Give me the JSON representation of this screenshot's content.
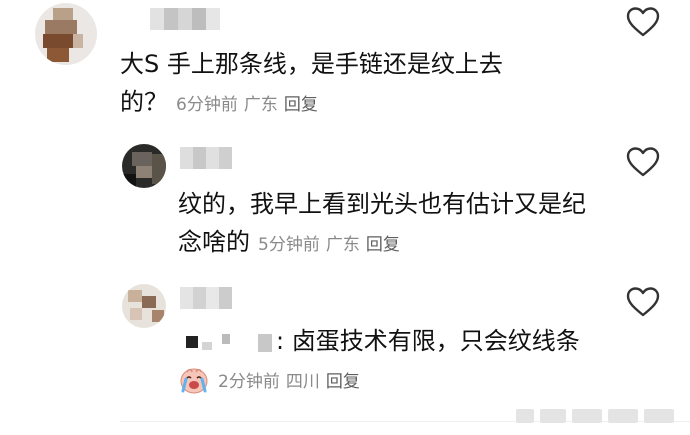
{
  "comments": [
    {
      "text": "大S 手上那条线，是手链还是纹上去的？",
      "meta": {
        "time": "6分钟前",
        "location": "广东",
        "reply": "回复"
      },
      "icon": "heart-outline-icon"
    },
    {
      "text": "纹的，我早上看到光头也有估计又是纪念啥的",
      "meta": {
        "time": "5分钟前",
        "location": "广东",
        "reply": "回复"
      },
      "icon": "heart-outline-icon"
    },
    {
      "text_suffix": ": 卤蛋技术有限，只会纹线条",
      "emoji": "crying-face-emoji",
      "meta": {
        "time": "2分钟前",
        "location": "四川",
        "reply": "回复"
      },
      "icon": "heart-outline-icon"
    }
  ],
  "colors": {
    "text": "#111111",
    "meta": "#8a8a8a",
    "reply": "#5f5f5f",
    "icon": "#333333"
  }
}
